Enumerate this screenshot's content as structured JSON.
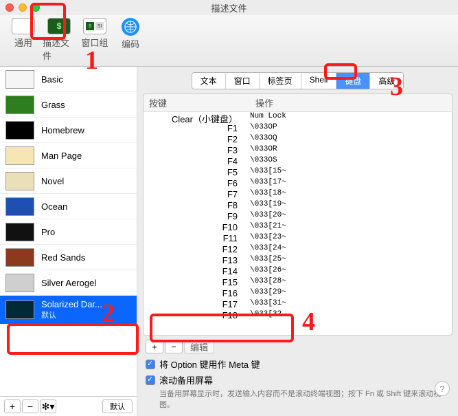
{
  "window": {
    "title": "描述文件"
  },
  "toolbar": {
    "general": "通用",
    "profiles": "描述文件",
    "groups": "窗口组",
    "encoding": "编码"
  },
  "profiles": [
    {
      "name": "Basic",
      "thumb": "#f5f5f5"
    },
    {
      "name": "Grass",
      "thumb": "#2e7d1f"
    },
    {
      "name": "Homebrew",
      "thumb": "#000000"
    },
    {
      "name": "Man Page",
      "thumb": "#f5e6b3"
    },
    {
      "name": "Novel",
      "thumb": "#eadfb8"
    },
    {
      "name": "Ocean",
      "thumb": "#1f4fb3"
    },
    {
      "name": "Pro",
      "thumb": "#111111"
    },
    {
      "name": "Red Sands",
      "thumb": "#8b3a1e"
    },
    {
      "name": "Silver Aerogel",
      "thumb": "#cfcfcf"
    },
    {
      "name": "Solarized Dar...",
      "sub": "默认",
      "thumb": "#002b36",
      "selected": true
    }
  ],
  "sidefoot": {
    "default_btn": "默认"
  },
  "tabs": {
    "text": "文本",
    "window": "窗口",
    "tab": "标签页",
    "shell": "Shell",
    "keyboard": "键盘",
    "advanced": "高级",
    "active": "keyboard"
  },
  "table": {
    "h_key": "按键",
    "h_action": "操作",
    "rows": [
      {
        "k": "Clear（小键盘）",
        "a": "Num Lock"
      },
      {
        "k": "F1",
        "a": "\\033OP"
      },
      {
        "k": "F2",
        "a": "\\033OQ"
      },
      {
        "k": "F3",
        "a": "\\033OR"
      },
      {
        "k": "F4",
        "a": "\\033OS"
      },
      {
        "k": "F5",
        "a": "\\033[15~"
      },
      {
        "k": "F6",
        "a": "\\033[17~"
      },
      {
        "k": "F7",
        "a": "\\033[18~"
      },
      {
        "k": "F8",
        "a": "\\033[19~"
      },
      {
        "k": "F9",
        "a": "\\033[20~"
      },
      {
        "k": "F10",
        "a": "\\033[21~"
      },
      {
        "k": "F11",
        "a": "\\033[23~"
      },
      {
        "k": "F12",
        "a": "\\033[24~"
      },
      {
        "k": "F13",
        "a": "\\033[25~"
      },
      {
        "k": "F14",
        "a": "\\033[26~"
      },
      {
        "k": "F15",
        "a": "\\033[28~"
      },
      {
        "k": "F16",
        "a": "\\033[29~"
      },
      {
        "k": "F17",
        "a": "\\033[31~"
      },
      {
        "k": "F18",
        "a": "\\033[32"
      }
    ]
  },
  "checks": {
    "option_meta": "将 Option 键用作 Meta 键",
    "scroll_alt": "滚动备用屏幕",
    "hint": "当备用屏幕显示时，发送输入内容而不是滚动终端视图；按下 Fn 或 Shift 键来滚动视图。"
  },
  "edit_btn": "编辑",
  "annotations": {
    "n1": "1",
    "n2": "2",
    "n3": "3",
    "n4": "4"
  }
}
